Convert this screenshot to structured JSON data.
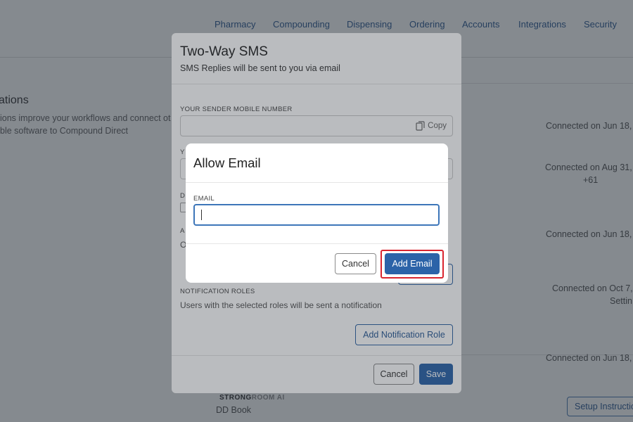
{
  "nav": {
    "items": [
      "Pharmacy",
      "Compounding",
      "Dispensing",
      "Ordering",
      "Accounts",
      "Integrations",
      "Security"
    ]
  },
  "integrations_page": {
    "heading": "ations",
    "description_line1": "ions improve your workflows and connect ot",
    "description_line2": "ble software to Compound Direct",
    "rows": [
      {
        "status": "Connected on Jun 18,"
      },
      {
        "status": "Connected on Aug 31,",
        "extra": "+61"
      },
      {
        "status": "Connected on Jun 18,"
      },
      {
        "status": "Connected on Oct 7,",
        "extra": "Settin"
      },
      {
        "status": "Connected on Jun 18,"
      }
    ],
    "strongroom_logo": "STRONGROOM AI",
    "strongroom_name": "DD Book",
    "setup_button": "Setup Instructio"
  },
  "sms_modal": {
    "title": "Two-Way SMS",
    "subtitle": "SMS Replies will be sent to you via email",
    "sender_label": "YOUR SENDER MOBILE NUMBER",
    "copy_label": "Copy",
    "partial_label_1": "Y",
    "partial_label_2": "D",
    "partial_label_3": "A",
    "partial_text_3": "O",
    "notification_roles_label": "NOTIFICATION ROLES",
    "notification_roles_desc": "Users with the selected roles will be sent a notification",
    "add_role_button": "Add Notification Role",
    "cancel_button": "Cancel",
    "save_button": "Save"
  },
  "email_dialog": {
    "title": "Allow Email",
    "email_label": "EMAIL",
    "email_value": "",
    "cancel_button": "Cancel",
    "add_button": "Add Email"
  },
  "colors": {
    "primary": "#2c63a8",
    "nav_link": "#1d4e89",
    "highlight": "#d9252f"
  }
}
